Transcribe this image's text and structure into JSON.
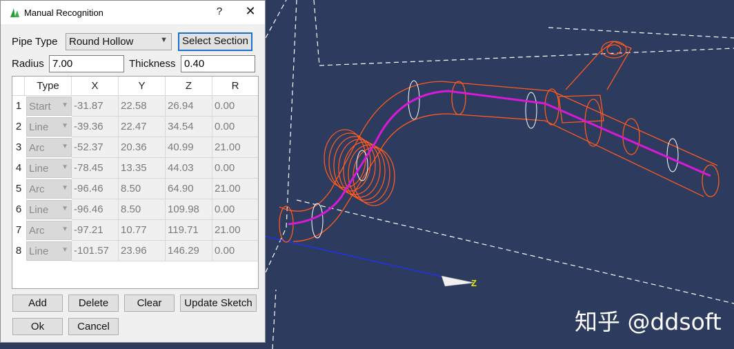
{
  "dialog": {
    "title": "Manual Recognition",
    "help_label": "?",
    "close_label": "✕",
    "pipe_type_label": "Pipe Type",
    "pipe_type_value": "Round Hollow",
    "select_section_label": "Select Section",
    "radius_label": "Radius",
    "radius_value": "7.00",
    "thickness_label": "Thickness",
    "thickness_value": "0.40",
    "columns": [
      "Type",
      "X",
      "Y",
      "Z",
      "R"
    ],
    "rows": [
      {
        "num": "1",
        "type": "Start",
        "x": "-31.87",
        "y": "22.58",
        "z": "26.94",
        "r": "0.00"
      },
      {
        "num": "2",
        "type": "Line",
        "x": "-39.36",
        "y": "22.47",
        "z": "34.54",
        "r": "0.00"
      },
      {
        "num": "3",
        "type": "Arc",
        "x": "-52.37",
        "y": "20.36",
        "z": "40.99",
        "r": "21.00"
      },
      {
        "num": "4",
        "type": "Line",
        "x": "-78.45",
        "y": "13.35",
        "z": "44.03",
        "r": "0.00"
      },
      {
        "num": "5",
        "type": "Arc",
        "x": "-96.46",
        "y": "8.50",
        "z": "64.90",
        "r": "21.00"
      },
      {
        "num": "6",
        "type": "Line",
        "x": "-96.46",
        "y": "8.50",
        "z": "109.98",
        "r": "0.00"
      },
      {
        "num": "7",
        "type": "Arc",
        "x": "-97.21",
        "y": "10.77",
        "z": "119.71",
        "r": "21.00"
      },
      {
        "num": "8",
        "type": "Line",
        "x": "-101.57",
        "y": "23.96",
        "z": "146.29",
        "r": "0.00"
      }
    ],
    "buttons": {
      "add": "Add",
      "delete": "Delete",
      "clear": "Clear",
      "update_sketch": "Update Sketch",
      "ok": "Ok",
      "cancel": "Cancel"
    }
  },
  "viewport": {
    "axis_label": "Z",
    "watermark": "知乎 @ddsoft"
  },
  "colors": {
    "viewport_bg": "#2c3b5e",
    "pipe_wire": "#ff5a1f",
    "centerline": "#d61ad6",
    "section_rings": "#ffffff",
    "axis": "#2030ff",
    "axis_label": "#e8e800"
  }
}
